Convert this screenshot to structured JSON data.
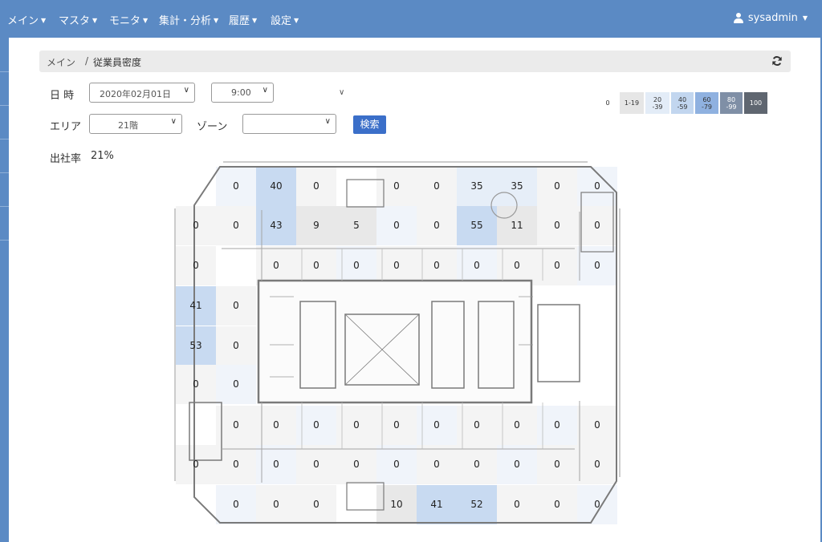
{
  "nav": {
    "items": [
      "メイン",
      "マスタ",
      "モニタ",
      "集計・分析",
      "履歴",
      "設定"
    ],
    "username": "sysadmin"
  },
  "breadcrumb": {
    "root": "メイン",
    "separator": "/",
    "current": "従業員密度"
  },
  "form": {
    "date_label": "日 時",
    "date_value": "2020年02月01日",
    "time_value": "9:00",
    "area_label": "エリア",
    "area_value": "21階",
    "zone_label": "ゾーン",
    "zone_value": "",
    "search_label": "検索"
  },
  "attendance": {
    "label": "出社率",
    "value": "21%"
  },
  "legend": [
    {
      "label": "0",
      "color": "#ffffff",
      "text": "#333333"
    },
    {
      "label": "1-19",
      "color": "#e6e6e6",
      "text": "#333333"
    },
    {
      "label": "20\n-39",
      "color": "#e3ecf7",
      "text": "#333333"
    },
    {
      "label": "40\n-59",
      "color": "#c2d6ef",
      "text": "#333333"
    },
    {
      "label": "60\n-79",
      "color": "#8fb1e0",
      "text": "#333333"
    },
    {
      "label": "80\n-99",
      "color": "#7f8fa6",
      "text": "#ffffff"
    },
    {
      "label": "100",
      "color": "#5f6670",
      "text": "#ffffff"
    }
  ],
  "density": {
    "rows": [
      [
        "0",
        "40",
        "0",
        "",
        "0",
        "0",
        "35",
        "35",
        "0",
        "0"
      ],
      [
        "0",
        "0",
        "43",
        "9",
        "5",
        "0",
        "0",
        "55",
        "11",
        "0",
        "0"
      ],
      [
        "0",
        "",
        "0",
        "0",
        "0",
        "0",
        "0",
        "0",
        "0",
        "0",
        "0"
      ],
      [
        "41",
        "0"
      ],
      [
        "53",
        "0"
      ],
      [
        "0",
        "0"
      ],
      [
        "",
        "0",
        "0",
        "0",
        "0",
        "0",
        "0",
        "0",
        "0",
        "0",
        "0"
      ],
      [
        "0",
        "0",
        "0",
        "0",
        "0",
        "0",
        "0",
        "0",
        "0",
        "0",
        "0"
      ],
      [
        "",
        "0",
        "0",
        "0",
        "",
        "10",
        "41",
        "52",
        "0",
        "0",
        "0"
      ]
    ]
  }
}
